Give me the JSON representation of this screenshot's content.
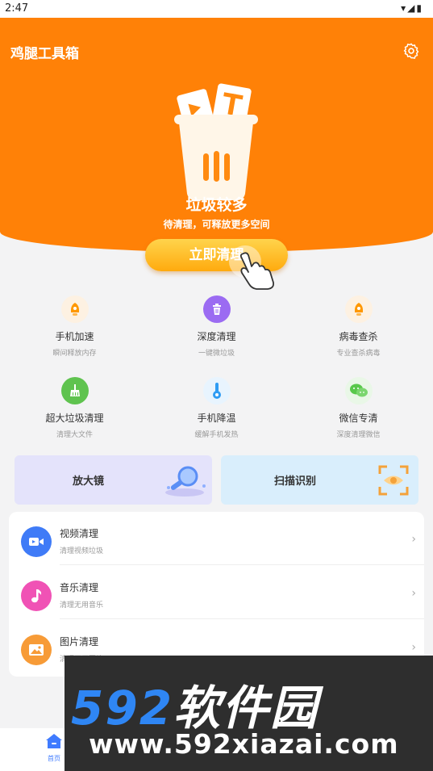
{
  "status": {
    "time": "2:47"
  },
  "app": {
    "title": "鸡腿工具箱"
  },
  "hero": {
    "title": "垃圾较多",
    "subtitle": "待清理，可释放更多空间",
    "button": "立即清理",
    "page_count": 5,
    "active_page": 1
  },
  "features": [
    {
      "title": "手机加速",
      "sub": "瞬间释放内存",
      "icon": "rocket-bell-icon",
      "color": "#ff9800"
    },
    {
      "title": "深度清理",
      "sub": "一键微垃圾",
      "icon": "trash-icon",
      "color": "#9b6bf2"
    },
    {
      "title": "病毒查杀",
      "sub": "专业查杀病毒",
      "icon": "shield-bell-icon",
      "color": "#ff9800"
    },
    {
      "title": "超大垃圾清理",
      "sub": "清理大文件",
      "icon": "broom-icon",
      "color": "#5fc34f"
    },
    {
      "title": "手机降温",
      "sub": "缓解手机发热",
      "icon": "thermometer-icon",
      "color": "#2f9cf3"
    },
    {
      "title": "微信专清",
      "sub": "深度清理微信",
      "icon": "wechat-icon",
      "color": "#58c84b"
    }
  ],
  "cards": [
    {
      "label": "放大镜",
      "icon": "magnifier-icon",
      "color": "#e4e3fb"
    },
    {
      "label": "扫描识别",
      "icon": "scan-eye-icon",
      "color": "#d9eefc"
    }
  ],
  "list": [
    {
      "title": "视频清理",
      "sub": "清理视频垃圾",
      "icon": "video-icon",
      "color": "#3f7bf7"
    },
    {
      "title": "音乐清理",
      "sub": "清理无用音乐",
      "icon": "music-icon",
      "color": "#f052b5"
    },
    {
      "title": "图片清理",
      "sub": "清理无用图片",
      "icon": "image-icon",
      "color": "#f79b37"
    }
  ],
  "tabbar": {
    "home": "首页"
  },
  "watermark": {
    "line1_num": "592",
    "line1_cn": "软件园",
    "line2": "www.592xiazai.com"
  }
}
